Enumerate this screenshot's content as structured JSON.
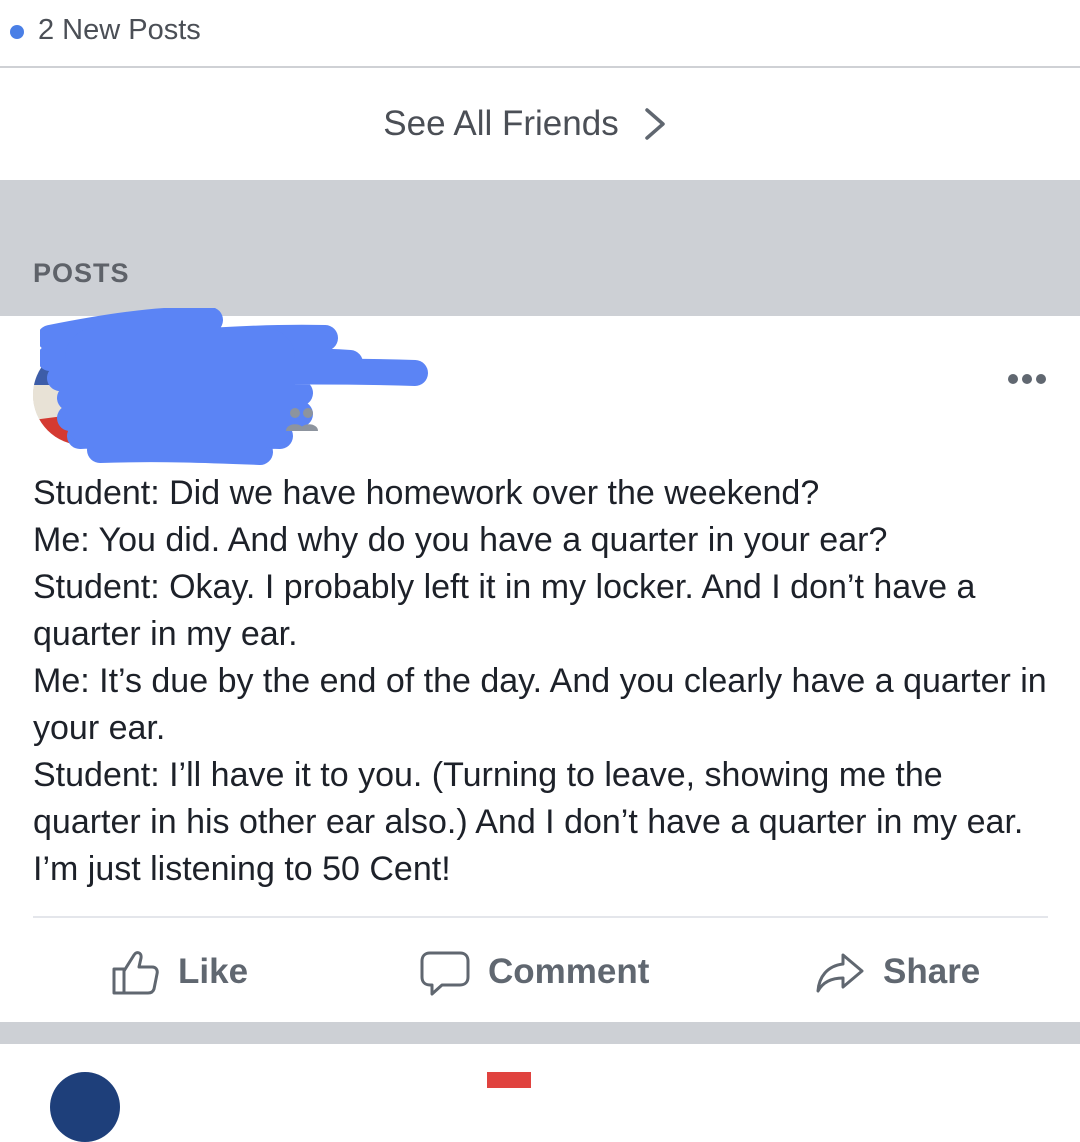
{
  "top": {
    "new_posts": "2 New Posts"
  },
  "friends": {
    "see_all": "See All Friends"
  },
  "section": {
    "posts_label": "POSTS"
  },
  "post": {
    "lines": [
      "Student: Did we have homework over the weekend?",
      "Me: You did. And why do you have a quarter in your ear?",
      "Student: Okay. I probably left it in my locker. And I don’t have a quarter in my ear.",
      "Me: It’s due by the end of the day. And you clearly have a quarter in your ear.",
      "Student: I’ll have it to you. (Turning to leave, showing me the quarter in his other ear also.) And I don’t have a quarter in my ear. I’m just listening to 50 Cent!"
    ],
    "actions": {
      "like": "Like",
      "comment": "Comment",
      "share": "Share"
    }
  },
  "colors": {
    "unread_dot": "#4a7fe6",
    "redaction": "#5b84f5",
    "band": "#cdd0d5"
  },
  "icons": [
    "chevron-right-icon",
    "more-icon",
    "group-icon",
    "like-icon",
    "comment-icon",
    "share-icon"
  ]
}
